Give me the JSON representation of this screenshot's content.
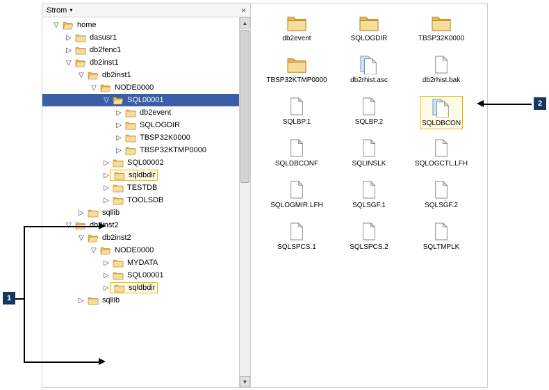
{
  "header": {
    "title": "Strom",
    "close": "×"
  },
  "tree": [
    {
      "depth": 0,
      "arrow": "▽",
      "open": true,
      "label": "home"
    },
    {
      "depth": 1,
      "arrow": "▷",
      "open": false,
      "label": "dasusr1"
    },
    {
      "depth": 1,
      "arrow": "▷",
      "open": false,
      "label": "db2fenc1"
    },
    {
      "depth": 1,
      "arrow": "▽",
      "open": true,
      "label": "db2inst1"
    },
    {
      "depth": 2,
      "arrow": "▽",
      "open": true,
      "label": "db2inst1"
    },
    {
      "depth": 3,
      "arrow": "▽",
      "open": true,
      "label": "NODE0000"
    },
    {
      "depth": 4,
      "arrow": "▽",
      "open": true,
      "label": "SQL00001",
      "selected": true
    },
    {
      "depth": 5,
      "arrow": "▷",
      "open": false,
      "label": "db2event"
    },
    {
      "depth": 5,
      "arrow": "▷",
      "open": false,
      "label": "SQLOGDIR"
    },
    {
      "depth": 5,
      "arrow": "▷",
      "open": false,
      "label": "TBSP32K0000"
    },
    {
      "depth": 5,
      "arrow": "▷",
      "open": false,
      "label": "TBSP32KTMP0000"
    },
    {
      "depth": 4,
      "arrow": "▷",
      "open": false,
      "label": "SQL00002"
    },
    {
      "depth": 4,
      "arrow": "▷",
      "open": false,
      "label": "sqldbdir",
      "highlight": true
    },
    {
      "depth": 4,
      "arrow": "▷",
      "open": false,
      "label": "TESTDB"
    },
    {
      "depth": 4,
      "arrow": "▷",
      "open": false,
      "label": "TOOLSDB"
    },
    {
      "depth": 2,
      "arrow": "▷",
      "open": false,
      "label": "sqllib"
    },
    {
      "depth": 1,
      "arrow": "▽",
      "open": true,
      "label": "db2inst2"
    },
    {
      "depth": 2,
      "arrow": "▽",
      "open": true,
      "label": "db2inst2"
    },
    {
      "depth": 3,
      "arrow": "▽",
      "open": true,
      "label": "NODE0000"
    },
    {
      "depth": 4,
      "arrow": "▷",
      "open": false,
      "label": "MYDATA"
    },
    {
      "depth": 4,
      "arrow": "▷",
      "open": false,
      "label": "SQL00001"
    },
    {
      "depth": 4,
      "arrow": "▷",
      "open": false,
      "label": "sqldbdir",
      "highlight": true
    },
    {
      "depth": 2,
      "arrow": "▷",
      "open": false,
      "label": "sqllib"
    }
  ],
  "items": [
    {
      "type": "folder",
      "name": "db2event"
    },
    {
      "type": "folder",
      "name": "SQLOGDIR"
    },
    {
      "type": "folder",
      "name": "TBSP32K0000"
    },
    {
      "type": "folder",
      "name": "TBSP32KTMP0000"
    },
    {
      "type": "filep",
      "name": "db2rhist.asc"
    },
    {
      "type": "file",
      "name": "db2rhist.bak"
    },
    {
      "type": "file",
      "name": "SQLBP.1"
    },
    {
      "type": "file",
      "name": "SQLBP.2"
    },
    {
      "type": "filep",
      "name": "SQLDBCON",
      "highlight": true
    },
    {
      "type": "file",
      "name": "SQLDBCONF"
    },
    {
      "type": "file",
      "name": "SQLINSLK"
    },
    {
      "type": "file",
      "name": "SQLOGCTL.LFH"
    },
    {
      "type": "file",
      "name": "SQLOGMIR.LFH"
    },
    {
      "type": "file",
      "name": "SQLSGF.1"
    },
    {
      "type": "file",
      "name": "SQLSGF.2"
    },
    {
      "type": "file",
      "name": "SQLSPCS.1"
    },
    {
      "type": "file",
      "name": "SQLSPCS.2"
    },
    {
      "type": "file",
      "name": "SQLTMPLK"
    }
  ],
  "callouts": {
    "one": "1",
    "two": "2"
  }
}
